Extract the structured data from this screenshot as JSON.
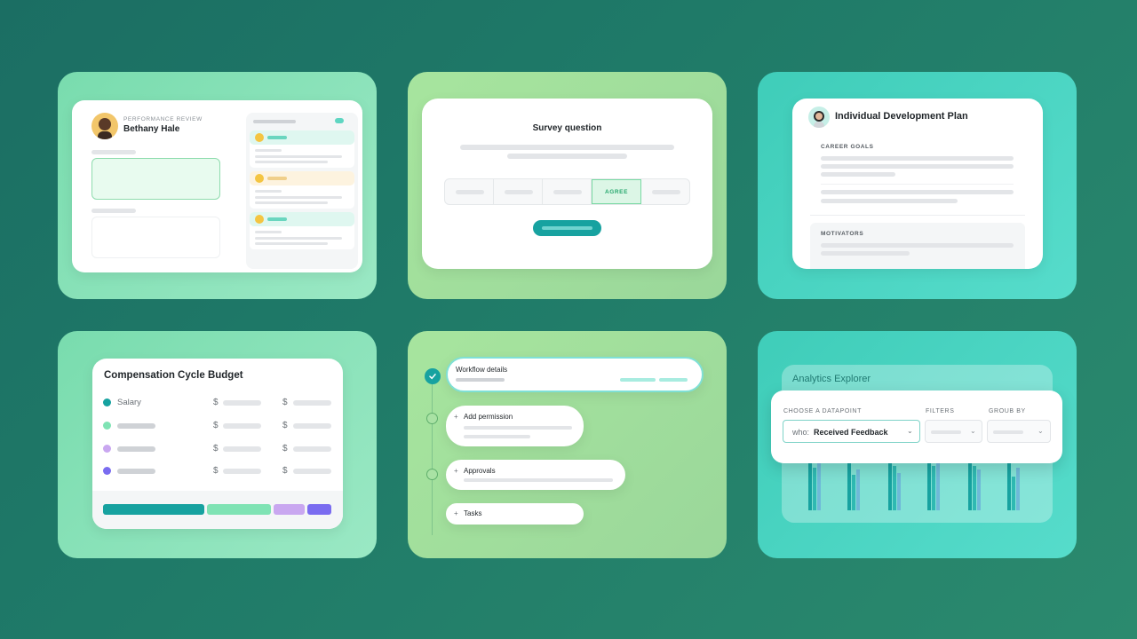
{
  "colors": {
    "accent_teal": "#17a2a0",
    "mint": "#7fe3b4",
    "lilac": "#c9a7f0",
    "violet": "#7a6cf0",
    "agree_green": "#27a86e"
  },
  "review": {
    "eyebrow": "PERFORMANCE REVIEW",
    "name": "Bethany Hale"
  },
  "survey": {
    "title": "Survey question",
    "options": [
      "",
      "",
      "",
      "AGREE",
      ""
    ],
    "selected": "AGREE"
  },
  "idp": {
    "title": "Individual Development Plan",
    "section1": "CAREER GOALS",
    "section2": "MOTIVATORS"
  },
  "budget": {
    "title": "Compensation Cycle Budget",
    "rows": [
      {
        "label": "Salary",
        "dot": "#17a2a0",
        "cur1": "$",
        "cur2": "$"
      },
      {
        "label": "",
        "dot": "#7fe3b4",
        "cur1": "$",
        "cur2": "$"
      },
      {
        "label": "",
        "dot": "#c9a7f0",
        "cur1": "$",
        "cur2": "$"
      },
      {
        "label": "",
        "dot": "#7a6cf0",
        "cur1": "$",
        "cur2": "$"
      }
    ]
  },
  "workflow": {
    "steps": [
      {
        "label": "Workflow details",
        "done": true
      },
      {
        "label": "Add permission",
        "prefix": "+"
      },
      {
        "label": "Approvals",
        "prefix": "+"
      },
      {
        "label": "Tasks",
        "prefix": "+"
      }
    ]
  },
  "analytics": {
    "title": "Analytics Explorer",
    "datapoint_label": "CHOOSE A DATAPOINT",
    "filters_label": "FILTERS",
    "group_label": "GROUB BY",
    "select_prefix": "who:",
    "select_value": "Received Feedback"
  }
}
